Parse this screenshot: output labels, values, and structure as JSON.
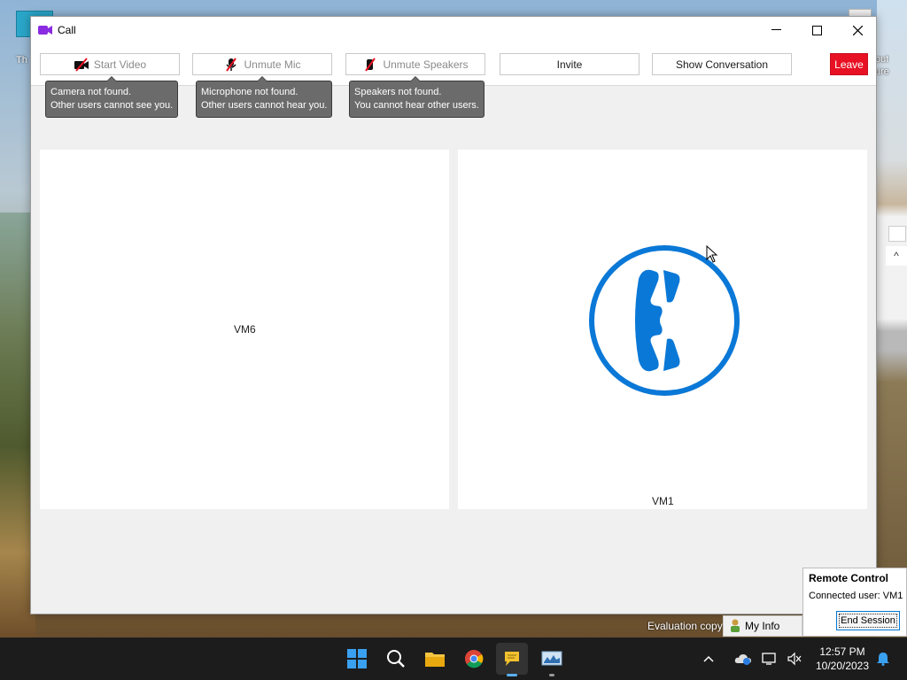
{
  "desktop": {
    "left_icon_text": "Th",
    "right_text_1": "out",
    "right_text_2": "ure",
    "right_caret": "^"
  },
  "window": {
    "title": "Call",
    "controls": {
      "minimize": "—",
      "maximize": "☐",
      "close": "✕"
    }
  },
  "toolbar": {
    "start_video": "Start Video",
    "unmute_mic": "Unmute Mic",
    "unmute_speakers": "Unmute Speakers",
    "invite": "Invite",
    "show_conversation": "Show Conversation",
    "leave": "Leave"
  },
  "tooltips": {
    "camera": {
      "line1": "Camera not found.",
      "line2": "Other users cannot see you."
    },
    "mic": {
      "line1": "Microphone not found.",
      "line2": "Other users cannot hear you."
    },
    "speakers": {
      "line1": "Speakers not found.",
      "line2": "You cannot hear other users."
    }
  },
  "participants": [
    {
      "name": "VM6"
    },
    {
      "name": "VM1"
    }
  ],
  "status": {
    "evaluation": "Evaluation copy",
    "my_info": "My Info"
  },
  "remote_control": {
    "title": "Remote Control",
    "connected_user": "Connected user: VM1",
    "end_session": "End Session"
  },
  "taskbar": {
    "time": "12:57 PM",
    "date": "10/20/2023",
    "apps": [
      "windows-start-icon",
      "search-icon",
      "file-explorer-icon",
      "chrome-icon",
      "chat-app-icon",
      "monitor-app-icon"
    ]
  },
  "colors": {
    "leave_red": "#e81123",
    "phone_blue": "#0a78d7",
    "mute_red": "#e81123"
  }
}
